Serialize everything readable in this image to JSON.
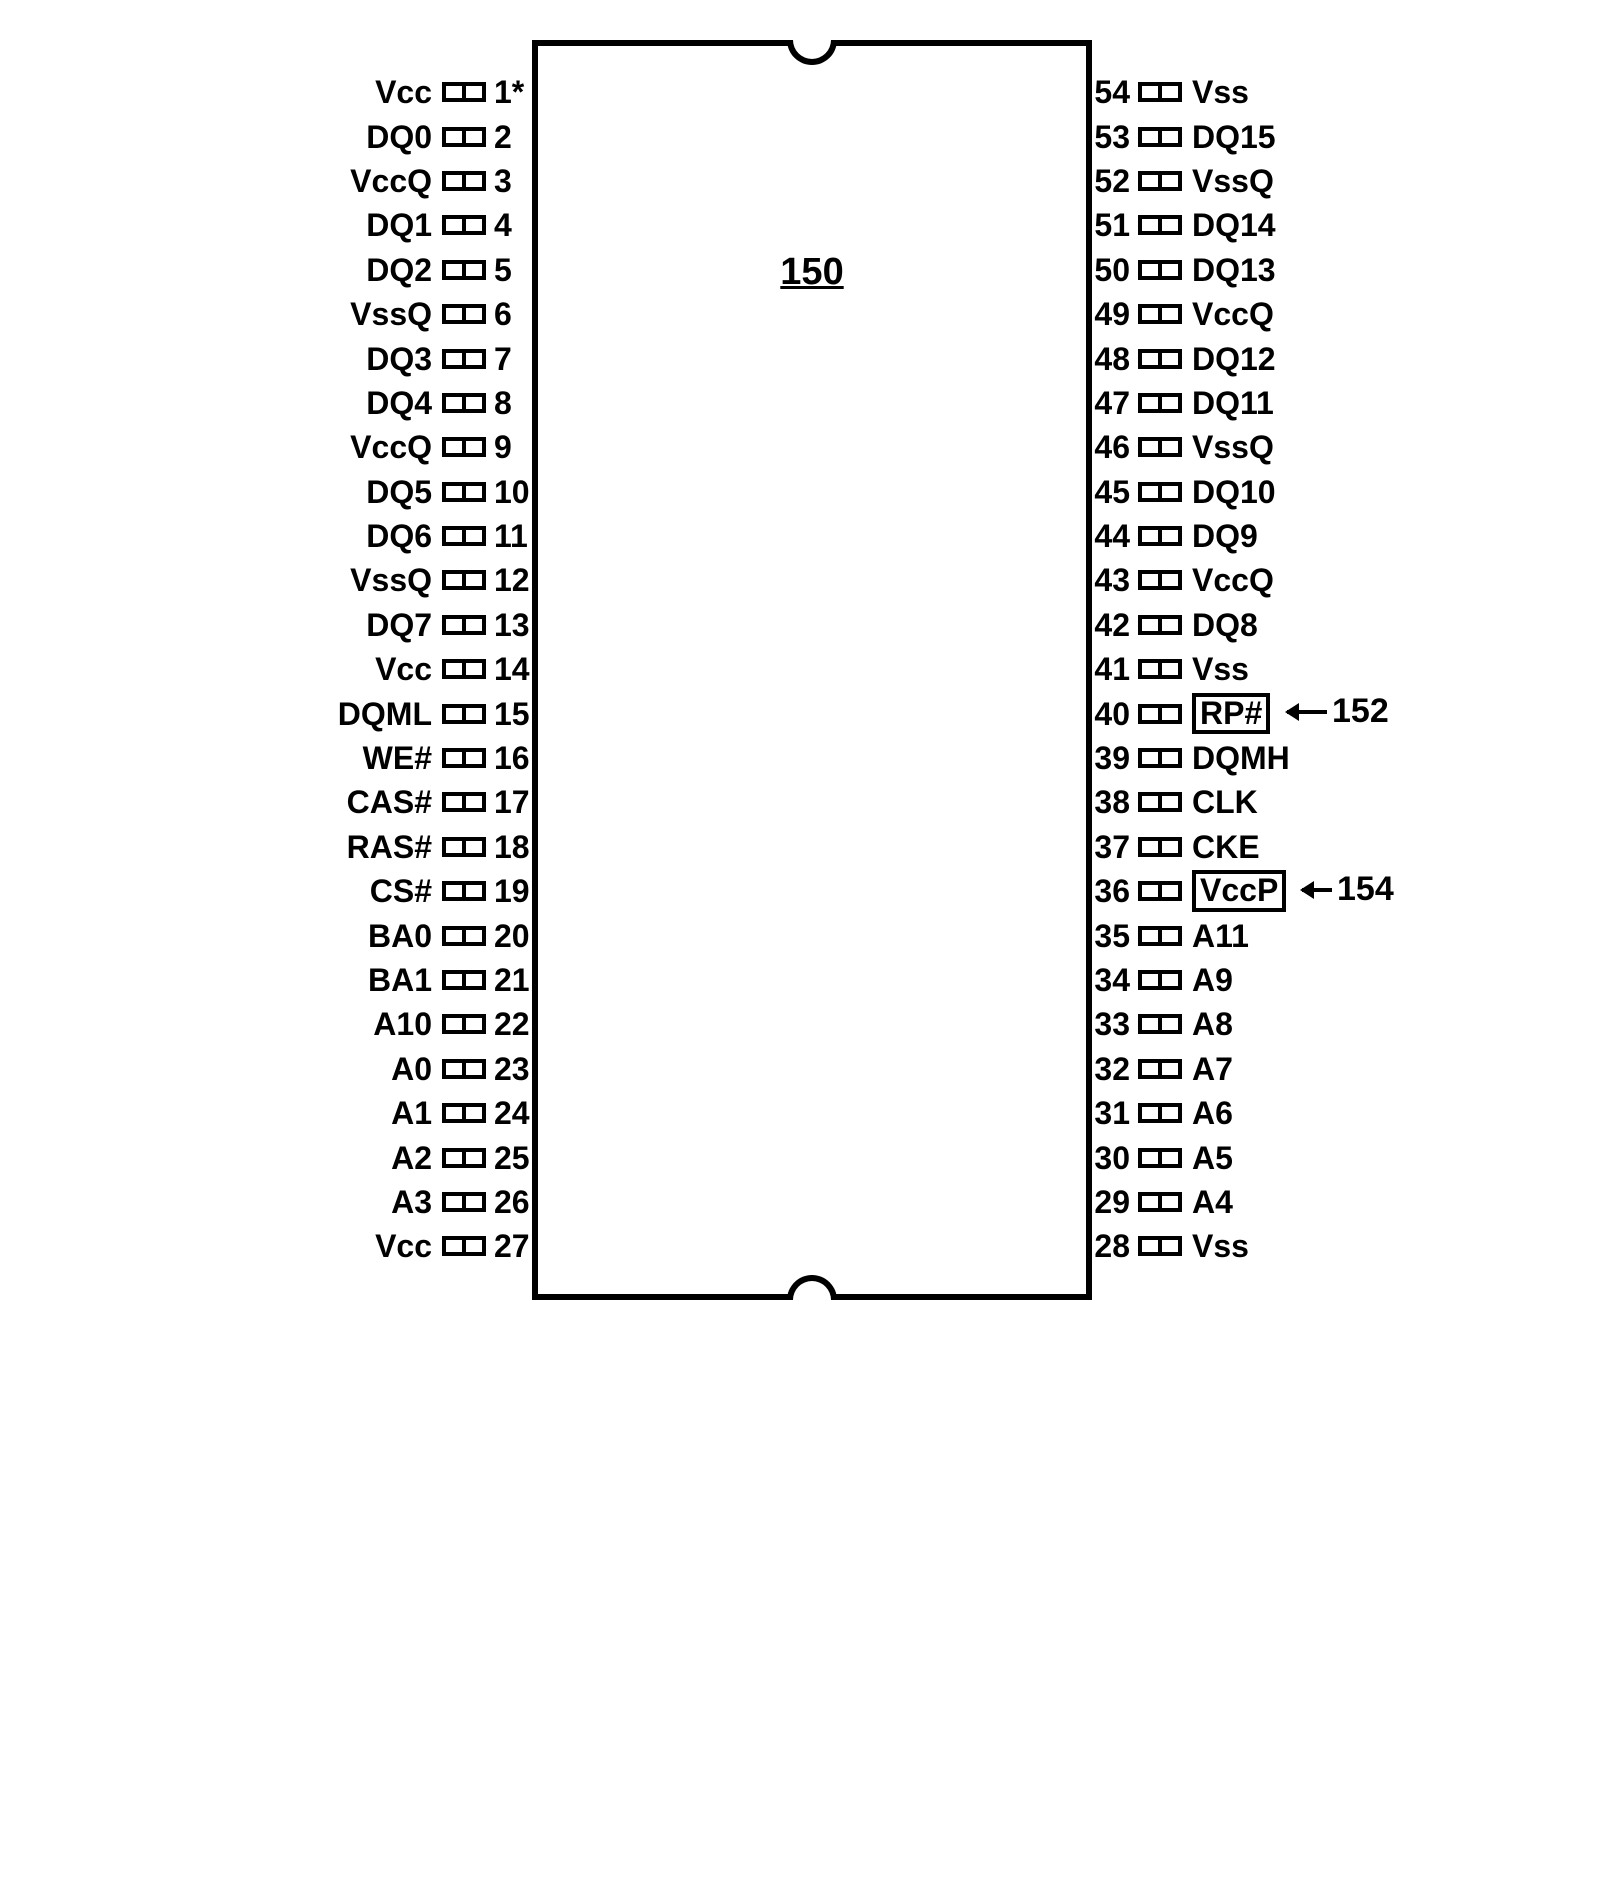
{
  "chip_ref": "150",
  "annotations": [
    {
      "ref": "152",
      "target_pin": 40
    },
    {
      "ref": "154",
      "target_pin": 36
    }
  ],
  "left_pins": [
    {
      "num": "1*",
      "label": "Vcc"
    },
    {
      "num": "2",
      "label": "DQ0"
    },
    {
      "num": "3",
      "label": "VccQ"
    },
    {
      "num": "4",
      "label": "DQ1"
    },
    {
      "num": "5",
      "label": "DQ2"
    },
    {
      "num": "6",
      "label": "VssQ"
    },
    {
      "num": "7",
      "label": "DQ3"
    },
    {
      "num": "8",
      "label": "DQ4"
    },
    {
      "num": "9",
      "label": "VccQ"
    },
    {
      "num": "10",
      "label": "DQ5"
    },
    {
      "num": "11",
      "label": "DQ6"
    },
    {
      "num": "12",
      "label": "VssQ"
    },
    {
      "num": "13",
      "label": "DQ7"
    },
    {
      "num": "14",
      "label": "Vcc"
    },
    {
      "num": "15",
      "label": "DQML"
    },
    {
      "num": "16",
      "label": "WE#"
    },
    {
      "num": "17",
      "label": "CAS#"
    },
    {
      "num": "18",
      "label": "RAS#"
    },
    {
      "num": "19",
      "label": "CS#"
    },
    {
      "num": "20",
      "label": "BA0"
    },
    {
      "num": "21",
      "label": "BA1"
    },
    {
      "num": "22",
      "label": "A10"
    },
    {
      "num": "23",
      "label": "A0"
    },
    {
      "num": "24",
      "label": "A1"
    },
    {
      "num": "25",
      "label": "A2"
    },
    {
      "num": "26",
      "label": "A3"
    },
    {
      "num": "27",
      "label": "Vcc"
    }
  ],
  "right_pins": [
    {
      "num": "54",
      "label": "Vss"
    },
    {
      "num": "53",
      "label": "DQ15"
    },
    {
      "num": "52",
      "label": "VssQ"
    },
    {
      "num": "51",
      "label": "DQ14"
    },
    {
      "num": "50",
      "label": "DQ13"
    },
    {
      "num": "49",
      "label": "VccQ"
    },
    {
      "num": "48",
      "label": "DQ12"
    },
    {
      "num": "47",
      "label": "DQ11"
    },
    {
      "num": "46",
      "label": "VssQ"
    },
    {
      "num": "45",
      "label": "DQ10"
    },
    {
      "num": "44",
      "label": "DQ9"
    },
    {
      "num": "43",
      "label": "VccQ"
    },
    {
      "num": "42",
      "label": "DQ8"
    },
    {
      "num": "41",
      "label": "Vss"
    },
    {
      "num": "40",
      "label": "RP#",
      "boxed": true
    },
    {
      "num": "39",
      "label": "DQMH"
    },
    {
      "num": "38",
      "label": "CLK"
    },
    {
      "num": "37",
      "label": "CKE"
    },
    {
      "num": "36",
      "label": "VccP",
      "boxed": true
    },
    {
      "num": "35",
      "label": "A11"
    },
    {
      "num": "34",
      "label": "A9"
    },
    {
      "num": "33",
      "label": "A8"
    },
    {
      "num": "32",
      "label": "A7"
    },
    {
      "num": "31",
      "label": "A6"
    },
    {
      "num": "30",
      "label": "A5"
    },
    {
      "num": "29",
      "label": "A4"
    },
    {
      "num": "28",
      "label": "Vss"
    }
  ]
}
